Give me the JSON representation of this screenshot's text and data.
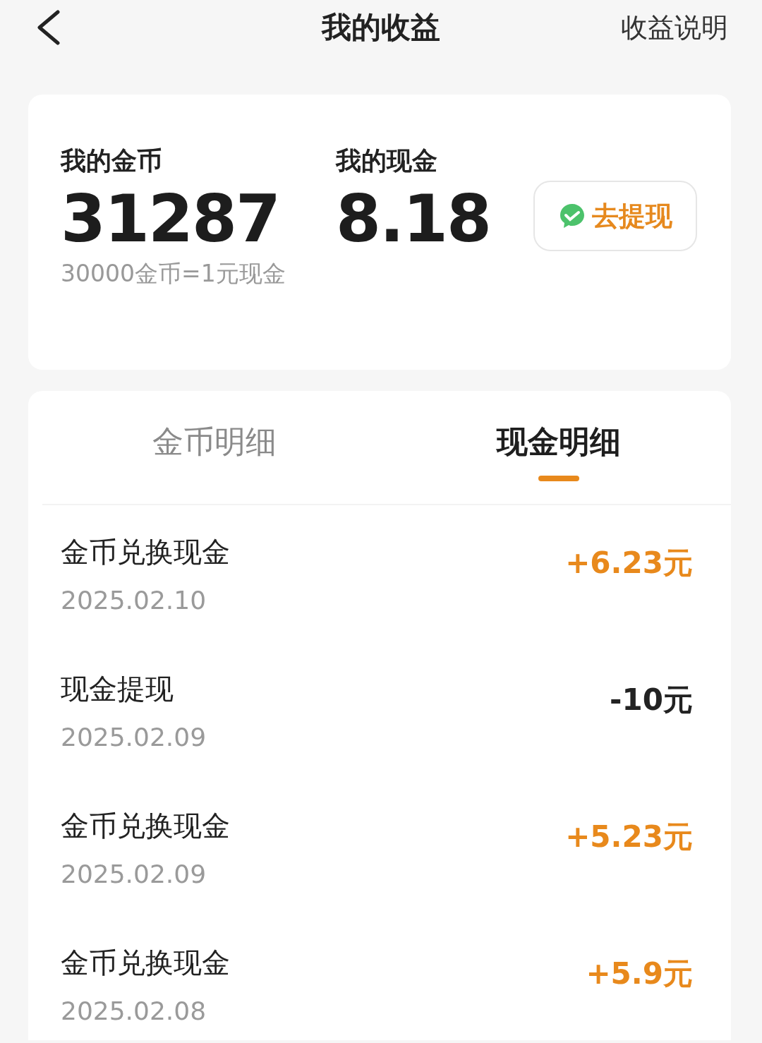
{
  "header": {
    "title": "我的收益",
    "link": "收益说明"
  },
  "summary": {
    "coins_label": "我的金币",
    "coins": "31287",
    "cash_label": "我的现金",
    "cash": "8.18",
    "rate": "30000金币=1元现金",
    "withdraw_button": "去提现"
  },
  "tabs": [
    {
      "label": "金币明细",
      "selected": false
    },
    {
      "label": "现金明细",
      "selected": true
    }
  ],
  "records": [
    {
      "title": "金币兑换现金",
      "date": "2025.02.10",
      "amount": "+6.23元",
      "kind": "income"
    },
    {
      "title": "现金提现",
      "date": "2025.02.09",
      "amount": "-10元",
      "kind": "expense"
    },
    {
      "title": "金币兑换现金",
      "date": "2025.02.09",
      "amount": "+5.23元",
      "kind": "income"
    },
    {
      "title": "金币兑换现金",
      "date": "2025.02.08",
      "amount": "+5.9元",
      "kind": "income"
    }
  ]
}
